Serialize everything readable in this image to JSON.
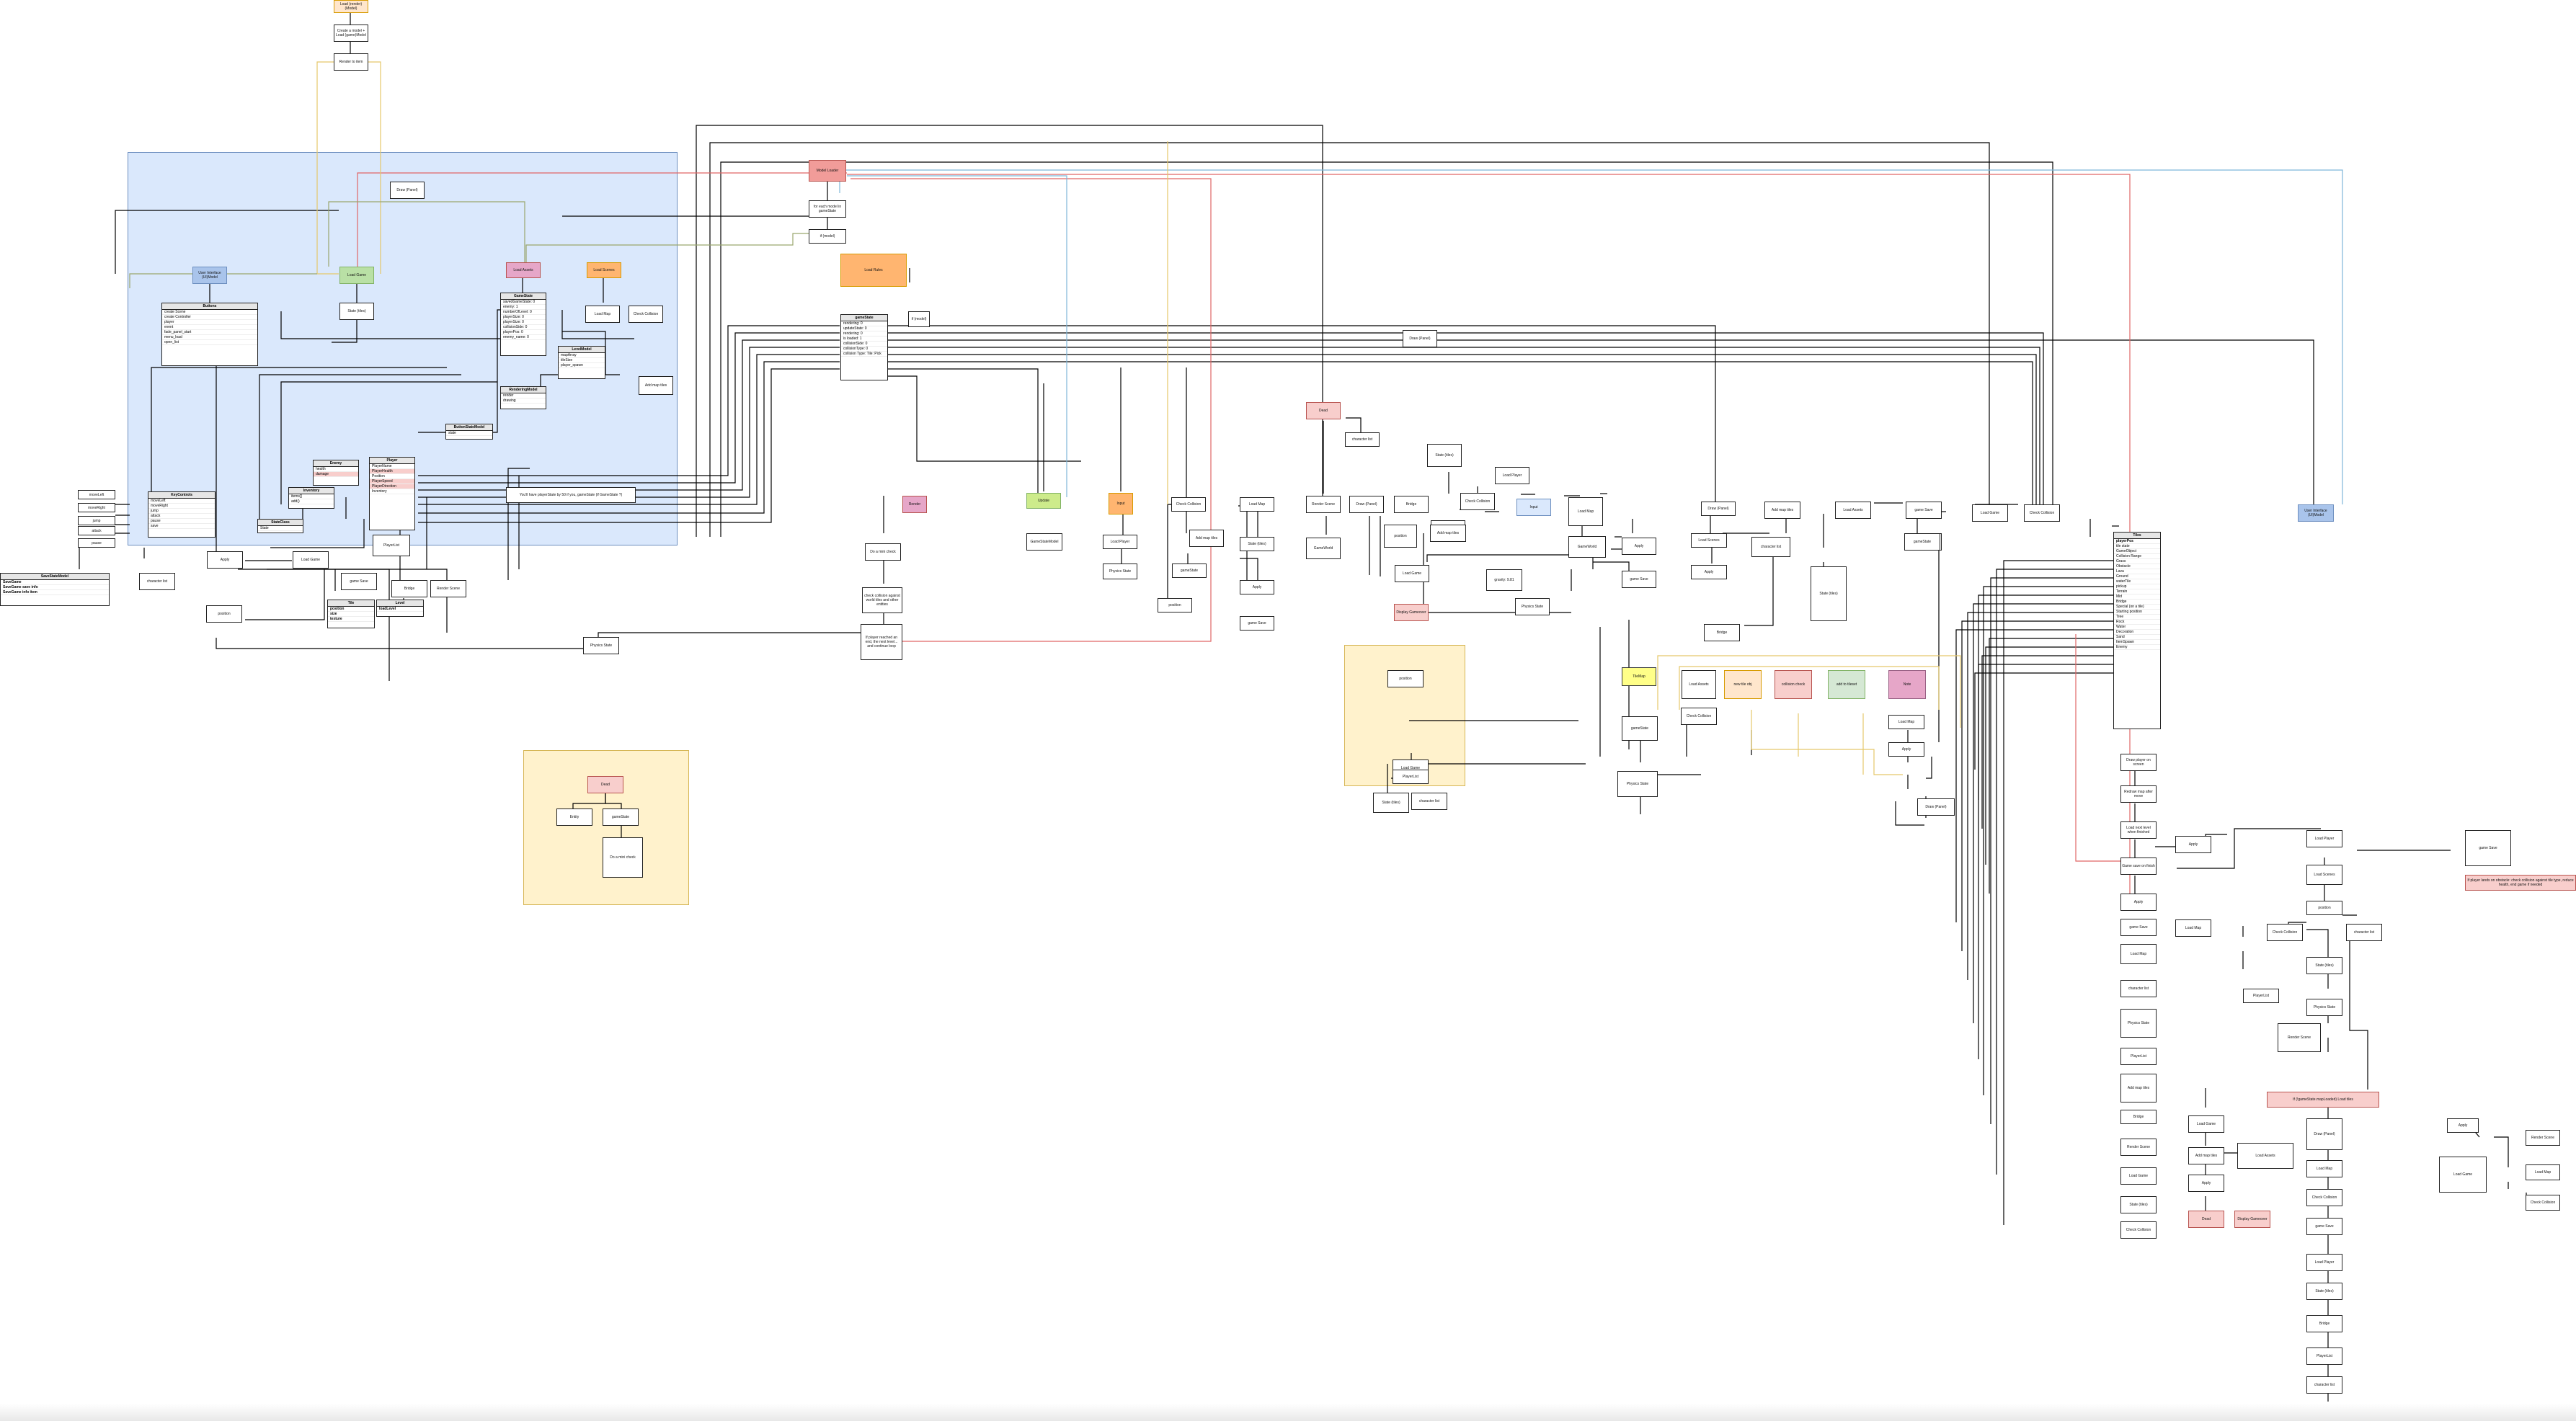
{
  "colors": {
    "canvas_bg": "#ffffff",
    "blue_region": "#dae8fc",
    "yellow_region": "#fff2cc",
    "orange_fill": "#ffe6cc",
    "orange_bold": "#ffb570",
    "red_fill": "#f8cecc",
    "green_fill": "#d5e8d4",
    "lime_fill": "#cdeb8b",
    "pink_fill": "#e6a6c8",
    "yellow_fill": "#ffff88",
    "blue_fill": "#a9c4eb",
    "wire": "#000000",
    "wire_red": "#e06666",
    "wire_blue": "#7eb6d9",
    "wire_yellow": "#e5c86a"
  },
  "nodes": {
    "top_start": "Load (render) (Model)",
    "top_2": "Create a model + Load (game)Model",
    "top_3": "Render to item",
    "floor_panel": "Draw (Panel)",
    "user_interface": "User Interface (UI)Model",
    "load_game": "Load Game",
    "load_assets": "Load Assets",
    "load_scenes": "Load Scenes",
    "gamestate": "GameStateModel",
    "load_map": "Load Map",
    "check_collision": "Check Collision",
    "load_player": "Load Player",
    "add_map_tiles": "Add map tiles",
    "player_list": "PlayerList",
    "gamestate_label": "gameState",
    "character_list": "character list",
    "cond_note": "You'll have playerState by 50 if you, gameState (if GameState ?)",
    "apply": "Apply",
    "load_game_note": "Load Game",
    "state_tiles": "State (tiles)",
    "bottom_note": "Entity",
    "pos_label": "position",
    "game_save": "game Save",
    "bridge_note": "Bridge",
    "render_scene": "Render Scene",
    "physics_state": "Physics State"
  },
  "center": {
    "model_header": "Model Loader",
    "model_sub": "for each model in gameState",
    "model_sub2": "if (model)",
    "render_header": "Load Rules",
    "render_class_title": "gameState",
    "render_rows": [
      "rendering: 0",
      "updateState: 0",
      "rendering: 0",
      "is loaded: 1",
      "collisionSide: 0",
      "collisionType: 0",
      "collision Type: Tile: Pick"
    ],
    "pink_small": "Render",
    "lime_node": "Update",
    "orange_small": "Input",
    "lower_note": "Do a mini check",
    "lower_note2": "check collision against world tiles and other entities",
    "lower_note3": "If player reached an end, the next level... and continue loop",
    "red_small": "Dead",
    "red_small2": "Display Gameover"
  },
  "classes": {
    "buttons": {
      "title": "Buttons",
      "rows": [
        "create Scene",
        "create Controller",
        "player",
        "event",
        "fade_panel_start",
        "menu_load",
        "open_list"
      ]
    },
    "gamestate_cls": {
      "title": "GameState",
      "rows": [
        "savedGameState: 0",
        "enemy: 1",
        "numberOfLevel: 0",
        "playerSize: 0",
        "playerSize: 0",
        "collisionSide: 0",
        "playerPos: 0",
        "enemy_name: 0"
      ]
    },
    "levelmodel": {
      "title": "LevelModel",
      "rows": [
        "mapArray",
        "tileSize",
        "player_spawn"
      ]
    },
    "rendermodel": {
      "title": "RenderingModel",
      "rows": [
        "render",
        "drawing"
      ]
    },
    "buttonstate": {
      "title": "ButtonStateModel",
      "rows": [
        "state"
      ]
    },
    "player_cls": {
      "title": "Player",
      "rows": [
        "PlayerName",
        "PlayerHealth",
        "Position",
        "PlayerSpeed",
        "PlayerDirection",
        "Inventory"
      ],
      "red": [
        1
      ]
    },
    "enemy_cls": {
      "title": "Enemy",
      "rows": [
        "health",
        "damage",
        "speed",
        "type"
      ]
    },
    "inventory_cls": {
      "title": "Inventory",
      "rows": [
        "items[]",
        "add()",
        "remove()"
      ]
    },
    "keycontrols": {
      "title": "KeyControls",
      "rows": [
        "moveLeft",
        "moveRight",
        "jump",
        "attack",
        "pause",
        "save"
      ]
    },
    "tile_cls": {
      "title": "Tile",
      "rows": [
        "position",
        "size",
        "texture",
        "isSolid"
      ]
    },
    "level_cls": {
      "title": "Level",
      "rows": [
        "loadLevel",
        "saveLevel"
      ]
    },
    "stateclass": {
      "title": "StateClass",
      "rows": [
        "State"
      ]
    },
    "savestate": {
      "title": "SaveStateModel",
      "rows": [
        "SaveGame",
        "SaveGame save info",
        "SaveGame info item"
      ]
    },
    "game_world": {
      "title": "GameWorld",
      "rows": [
        "gravity: 9.81",
        "friction: 0.5",
        "player"
      ]
    },
    "big_cls": {
      "title": "Tiles",
      "rows": [
        "playerPos",
        "tile state",
        "GameObject",
        "Collision Range",
        "Grass",
        "Obstacle",
        "Lava",
        "Ground",
        "waterTile",
        "pickup",
        "Terrain",
        "Mid",
        "Bridge",
        "Special (on a tile)",
        "Starting position",
        "Tree",
        "Rock",
        "Water",
        "Decoration",
        "Sand",
        "ItemSpawn",
        "Enemy"
      ]
    }
  },
  "right": {
    "yellow_title": "TileMap",
    "pink_r1": "new tile obj",
    "pink_r2": "collision check",
    "green_r": "add to tileset",
    "red_r": "Note",
    "pink_wide": "If (!gameState.mapLoaded) Load tiles",
    "red_wide": "If player lands on obstacle: check collision against tile type, reduce health, end game if needed"
  },
  "legend": {
    "box": "Labels",
    "rows": [
      "Draw player on screen",
      "Redraw map after move",
      "Load next level when finished",
      "Game save on finish"
    ]
  }
}
